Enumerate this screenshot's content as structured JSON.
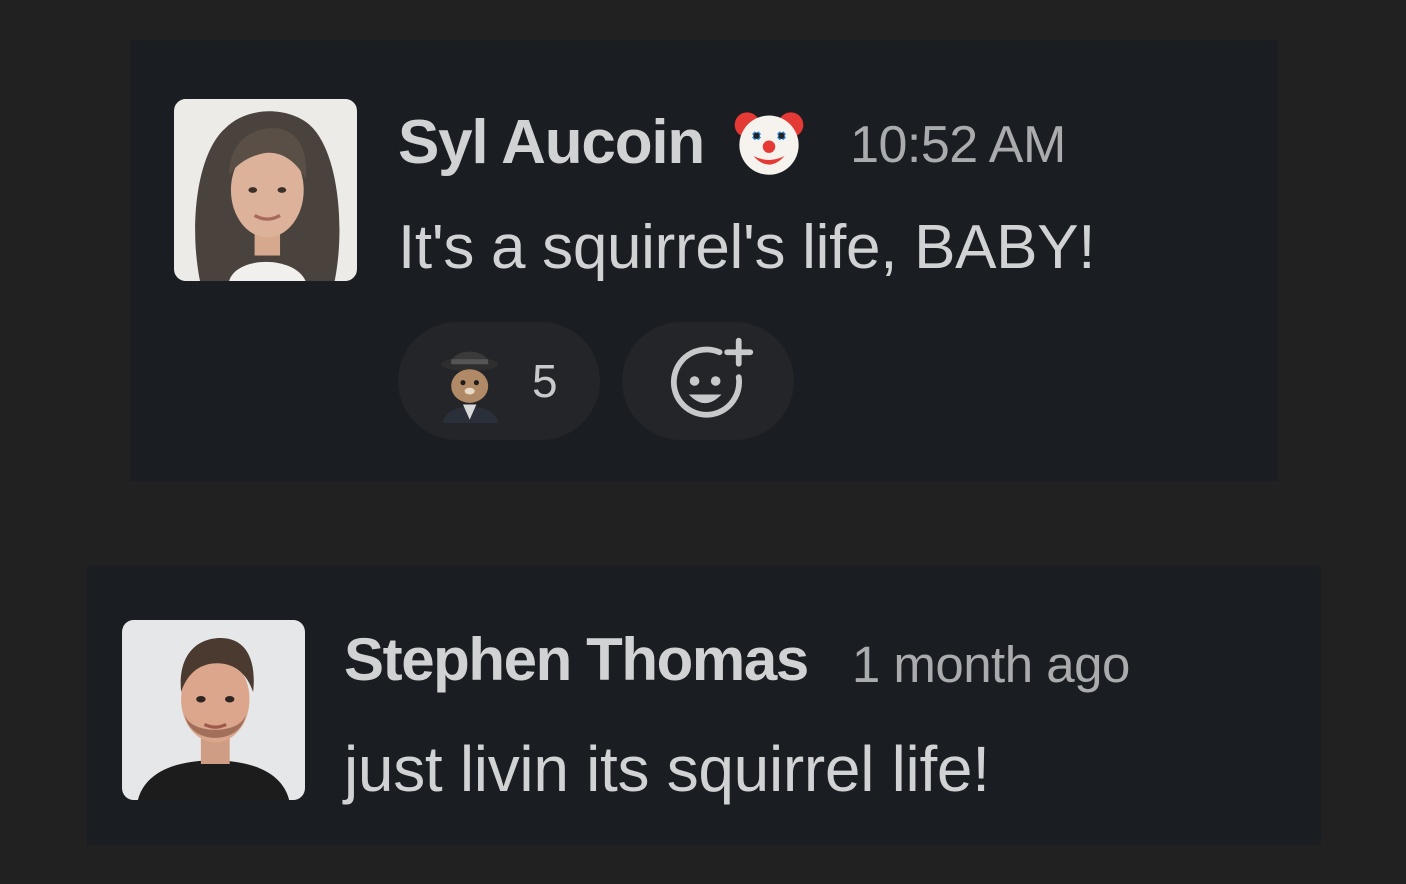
{
  "messages": [
    {
      "author": "Syl Aucoin",
      "avatar_icon": "user-avatar-photo",
      "status_emoji": "clown-face-icon",
      "timestamp": "10:52 AM",
      "text": "It's a squirrel's life, BABY!",
      "reactions": [
        {
          "emoji": "spy-squirrel-emoji",
          "count": "5"
        }
      ],
      "add_reaction_icon": "add-reaction-icon"
    },
    {
      "author": "Stephen Thomas",
      "avatar_icon": "user-avatar-photo",
      "timestamp": "1 month ago",
      "text": "just livin its squirrel life!"
    }
  ],
  "colors": {
    "page_background": "#212122",
    "card_background": "#1a1d21",
    "primary_text": "#d1d2d3",
    "secondary_text": "#aaabad",
    "reaction_pill": "#232529"
  }
}
